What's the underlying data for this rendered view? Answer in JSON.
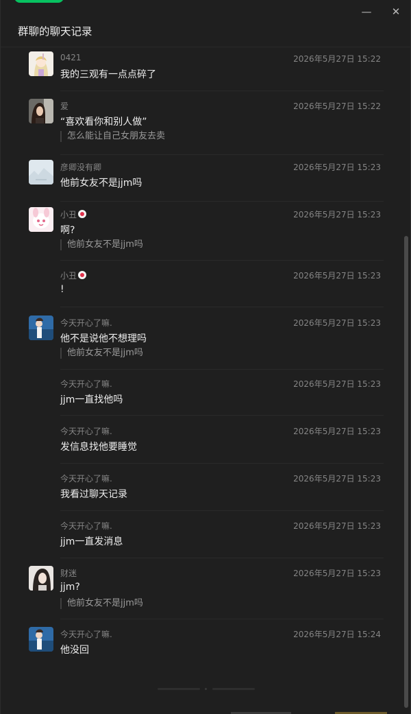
{
  "window": {
    "title": "群聊的聊天记录",
    "minimize_glyph": "—",
    "close_glyph": "✕"
  },
  "messages": [
    {
      "sender": "0421",
      "time": "2026年5月27日 15:22",
      "content": "我的三观有一点点碎了",
      "quote": "",
      "avatar": "anime-girl-avatar"
    },
    {
      "sender": "爱",
      "time": "2026年5月27日 15:22",
      "content": "“喜欢看你和别人做”",
      "quote": "怎么能让自己女朋友去卖",
      "avatar": "car-selfie-avatar"
    },
    {
      "sender": "彦卿没有卿",
      "time": "2026年5月27日 15:23",
      "content": "他前女友不是jjm吗",
      "quote": "",
      "avatar": "sky-avatar"
    },
    {
      "sender": "小丑",
      "time": "2026年5月27日 15:23",
      "content": "啊?",
      "quote": "他前女友不是jjm吗",
      "avatar": "pink-bunny-avatar"
    },
    {
      "sender": "小丑",
      "time": "2026年5月27日 15:23",
      "content": "!",
      "quote": "",
      "avatar": ""
    },
    {
      "sender": "今天开心了嘛.",
      "time": "2026年5月27日 15:23",
      "content": "他不是说他不想理吗",
      "quote": "他前女友不是jjm吗",
      "avatar": "beach-girl-avatar"
    },
    {
      "sender": "今天开心了嘛.",
      "time": "2026年5月27日 15:23",
      "content": "jjm一直找他吗",
      "quote": "",
      "avatar": ""
    },
    {
      "sender": "今天开心了嘛.",
      "time": "2026年5月27日 15:23",
      "content": "发信息找他要睡觉",
      "quote": "",
      "avatar": ""
    },
    {
      "sender": "今天开心了嘛.",
      "time": "2026年5月27日 15:23",
      "content": "我看过聊天记录",
      "quote": "",
      "avatar": ""
    },
    {
      "sender": "今天开心了嘛.",
      "time": "2026年5月27日 15:23",
      "content": "jjm一直发消息",
      "quote": "",
      "avatar": ""
    },
    {
      "sender": "财迷",
      "time": "2026年5月27日 15:23",
      "content": "jjm?",
      "quote": "他前女友不是jjm吗",
      "avatar": "girl-portrait-avatar"
    },
    {
      "sender": "今天开心了嘛.",
      "time": "2026年5月27日 15:24",
      "content": "他没回",
      "quote": "",
      "avatar": "beach-girl-avatar"
    }
  ],
  "colors": {
    "background": "#1f1f1f",
    "accent": "#07c160",
    "text_primary": "#ededed",
    "text_secondary": "#858585"
  }
}
